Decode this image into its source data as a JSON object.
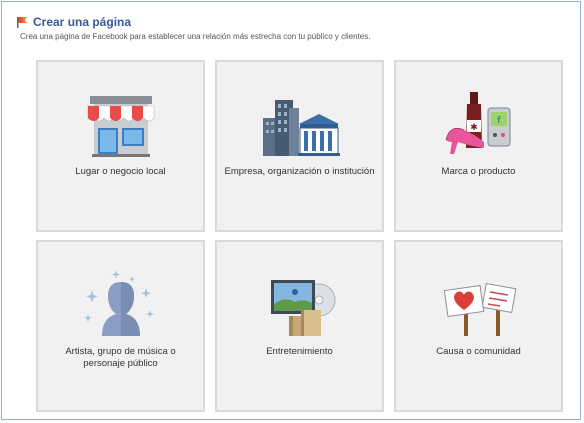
{
  "header": {
    "title": "Crear una página",
    "subtitle": "Crea una página de Facebook para establecer una relación más estrecha con tu público y clientes."
  },
  "categories": [
    {
      "label": "Lugar o negocio local",
      "icon": "storefront-icon"
    },
    {
      "label": "Empresa, organización o institución",
      "icon": "office-buildings-icon"
    },
    {
      "label": "Marca o producto",
      "icon": "brand-products-icon"
    },
    {
      "label": "Artista, grupo de música o personaje público",
      "icon": "person-silhouette-icon"
    },
    {
      "label": "Entretenimiento",
      "icon": "entertainment-media-icon"
    },
    {
      "label": "Causa o comunidad",
      "icon": "cause-signs-icon"
    }
  ],
  "colors": {
    "title": "#3b5998",
    "tile_bg": "#f1f1f1",
    "tile_border": "#d9d9d9",
    "frame_border": "#9ab1cc"
  }
}
